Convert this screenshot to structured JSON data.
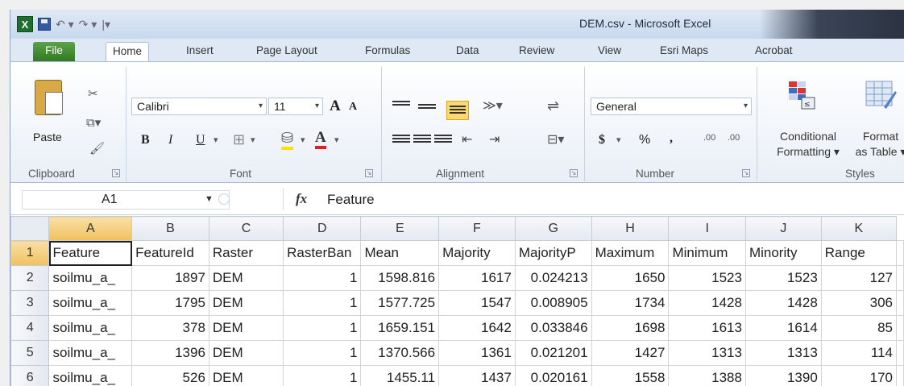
{
  "window": {
    "title": "DEM.csv  -  Microsoft Excel"
  },
  "tabs": [
    "File",
    "Home",
    "Insert",
    "Page Layout",
    "Formulas",
    "Data",
    "Review",
    "View",
    "Esri Maps",
    "Acrobat"
  ],
  "ribbon": {
    "clipboard": {
      "label": "Clipboard",
      "paste": "Paste"
    },
    "font": {
      "label": "Font",
      "name": "Calibri",
      "size": "11",
      "grow": "A",
      "shrink": "A",
      "bold": "B",
      "italic": "I",
      "underline": "U",
      "color": "A"
    },
    "alignment": {
      "label": "Alignment"
    },
    "number": {
      "label": "Number",
      "format": "General",
      "currency": "$",
      "percent": "%",
      "comma": ",",
      "inc_decimal": ".00",
      "dec_decimal": ".00"
    },
    "styles": {
      "label": "Styles",
      "conditional_1": "Conditional",
      "conditional_2": "Formatting ▾",
      "format_1": "Format",
      "format_2": "as Table ▾"
    }
  },
  "formula_bar": {
    "cell_ref": "A1",
    "fx": "fx",
    "value": "Feature"
  },
  "grid": {
    "columns": [
      "A",
      "B",
      "C",
      "D",
      "E",
      "F",
      "G",
      "H",
      "I",
      "J",
      "K"
    ],
    "rows": [
      {
        "n": "1",
        "cells": [
          "Feature",
          "FeatureId",
          "Raster",
          "RasterBan",
          "Mean",
          "Majority",
          "MajorityP",
          "Maximum",
          "Minimum",
          "Minority",
          "Range"
        ]
      },
      {
        "n": "2",
        "cells": [
          "soilmu_a_",
          "1897",
          "DEM",
          "1",
          "1598.816",
          "1617",
          "0.024213",
          "1650",
          "1523",
          "1523",
          "127"
        ]
      },
      {
        "n": "3",
        "cells": [
          "soilmu_a_",
          "1795",
          "DEM",
          "1",
          "1577.725",
          "1547",
          "0.008905",
          "1734",
          "1428",
          "1428",
          "306"
        ]
      },
      {
        "n": "4",
        "cells": [
          "soilmu_a_",
          "378",
          "DEM",
          "1",
          "1659.151",
          "1642",
          "0.033846",
          "1698",
          "1613",
          "1614",
          "85"
        ]
      },
      {
        "n": "5",
        "cells": [
          "soilmu_a_",
          "1396",
          "DEM",
          "1",
          "1370.566",
          "1361",
          "0.021201",
          "1427",
          "1313",
          "1313",
          "114"
        ]
      },
      {
        "n": "6",
        "cells": [
          "soilmu_a_",
          "526",
          "DEM",
          "1",
          "1455.11",
          "1437",
          "0.020161",
          "1558",
          "1388",
          "1390",
          "170"
        ]
      }
    ]
  },
  "colors": {
    "file_tab": "#2f7a22",
    "selected_header": "#f1c15f",
    "font_color_bar": "#e02020",
    "highlight_bar": "#ffe000"
  }
}
